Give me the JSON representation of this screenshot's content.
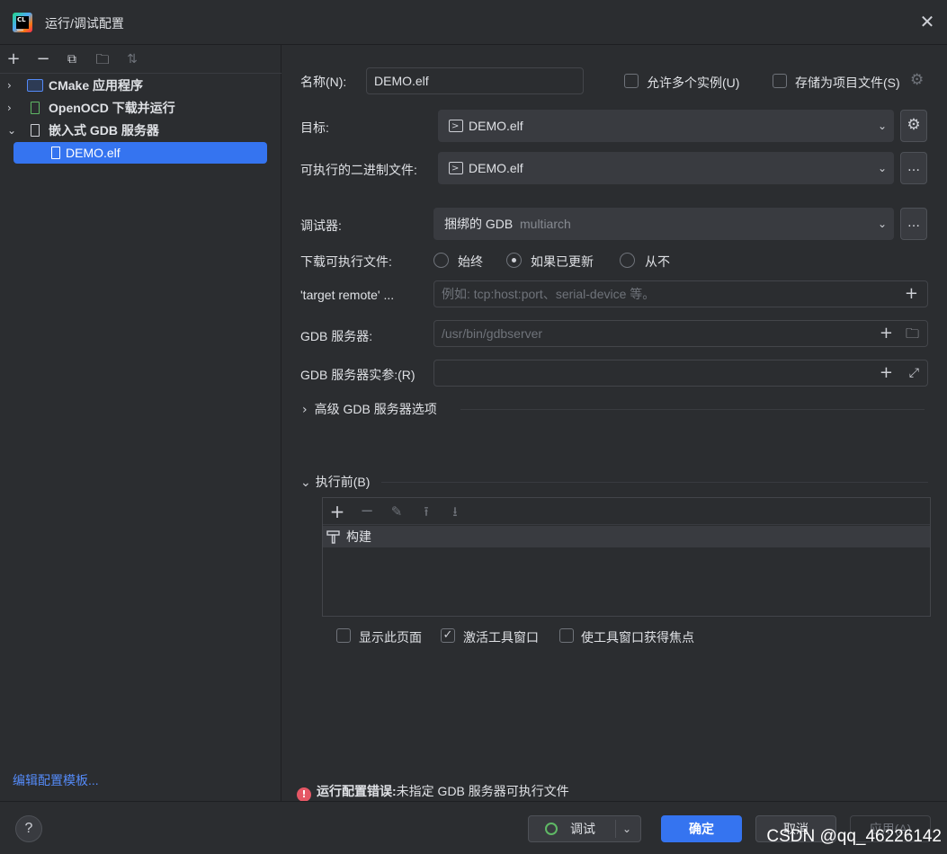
{
  "window": {
    "title": "运行/调试配置"
  },
  "left_panel": {
    "tree": [
      {
        "label": "CMake 应用程序",
        "icon": "cmake-app-icon"
      },
      {
        "label": "OpenOCD 下载并运行",
        "icon": "chip-icon"
      },
      {
        "label": "嵌入式 GDB 服务器",
        "icon": "chip-icon"
      }
    ],
    "selected_child": "DEMO.elf",
    "edit_templates": "编辑配置模板..."
  },
  "form": {
    "name_label": "名称(N):",
    "name_value": "DEMO.elf",
    "allow_multiple": "允许多个实例(U)",
    "store_as_project": "存储为项目文件(S)",
    "target_label": "目标:",
    "target_value": "DEMO.elf",
    "executable_label": "可执行的二进制文件:",
    "executable_value": "DEMO.elf",
    "debugger_label": "调试器:",
    "debugger_value": "捆绑的 GDB",
    "debugger_suffix": "multiarch",
    "download_label": "下载可执行文件:",
    "download_options": [
      "始终",
      "如果已更新",
      "从不"
    ],
    "target_remote_label": "'target remote' ...",
    "target_remote_placeholder": "例如: tcp:host:port、serial-device 等。",
    "gdb_server_label": "GDB 服务器:",
    "gdb_server_placeholder": "/usr/bin/gdbserver",
    "gdb_args_label": "GDB 服务器实参:(R)",
    "advanced_label": "高级 GDB 服务器选项",
    "before_launch_label": "执行前(B)",
    "before_launch_items": [
      "构建"
    ],
    "show_page": "显示此页面",
    "activate_tool_window": "激活工具窗口",
    "focus_tool_window": "使工具窗口获得焦点"
  },
  "error": {
    "bold": "运行配置错误:",
    "message": "未指定 GDB 服务器可执行文件"
  },
  "buttons": {
    "help": "?",
    "debug": "调试",
    "ok": "确定",
    "cancel": "取消",
    "apply": "应用(A)"
  },
  "watermark": "CSDN @qq_46226142",
  "colors": {
    "accent": "#3574f0",
    "background": "#2b2d30",
    "error": "#e55765",
    "link": "#548af7"
  }
}
